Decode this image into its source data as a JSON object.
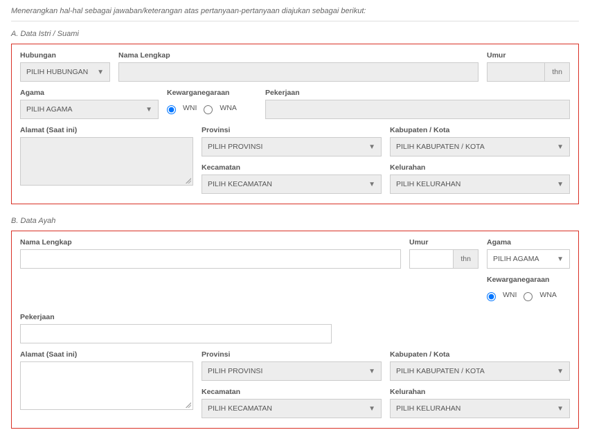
{
  "intro": "Menerangkan hal-hal sebagai jawaban/keterangan atas pertanyaan-pertanyaan diajukan sebagai berikut:",
  "sectionA": {
    "title": "A. Data Istri / Suami",
    "hubungan": {
      "label": "Hubungan",
      "value": "PILIH HUBUNGAN"
    },
    "nama": {
      "label": "Nama Lengkap"
    },
    "umur": {
      "label": "Umur",
      "suffix": "thn"
    },
    "agama": {
      "label": "Agama",
      "value": "PILIH AGAMA"
    },
    "kewarganegaraan": {
      "label": "Kewarganegaraan",
      "opt1": "WNI",
      "opt2": "WNA"
    },
    "pekerjaan": {
      "label": "Pekerjaan"
    },
    "alamat": {
      "label": "Alamat (Saat ini)"
    },
    "provinsi": {
      "label": "Provinsi",
      "value": "PILIH PROVINSI"
    },
    "kabupaten": {
      "label": "Kabupaten / Kota",
      "value": "PILIH KABUPATEN / KOTA"
    },
    "kecamatan": {
      "label": "Kecamatan",
      "value": "PILIH KECAMATAN"
    },
    "kelurahan": {
      "label": "Kelurahan",
      "value": "PILIH KELURAHAN"
    }
  },
  "sectionB": {
    "title": "B. Data Ayah",
    "nama": {
      "label": "Nama Lengkap"
    },
    "umur": {
      "label": "Umur",
      "suffix": "thn"
    },
    "agama": {
      "label": "Agama",
      "value": "PILIH AGAMA"
    },
    "kewarganegaraan": {
      "label": "Kewarganegaraan",
      "opt1": "WNI",
      "opt2": "WNA"
    },
    "pekerjaan": {
      "label": "Pekerjaan"
    },
    "alamat": {
      "label": "Alamat (Saat ini)"
    },
    "provinsi": {
      "label": "Provinsi",
      "value": "PILIH PROVINSI"
    },
    "kabupaten": {
      "label": "Kabupaten / Kota",
      "value": "PILIH KABUPATEN / KOTA"
    },
    "kecamatan": {
      "label": "Kecamatan",
      "value": "PILIH KECAMATAN"
    },
    "kelurahan": {
      "label": "Kelurahan",
      "value": "PILIH KELURAHAN"
    }
  }
}
